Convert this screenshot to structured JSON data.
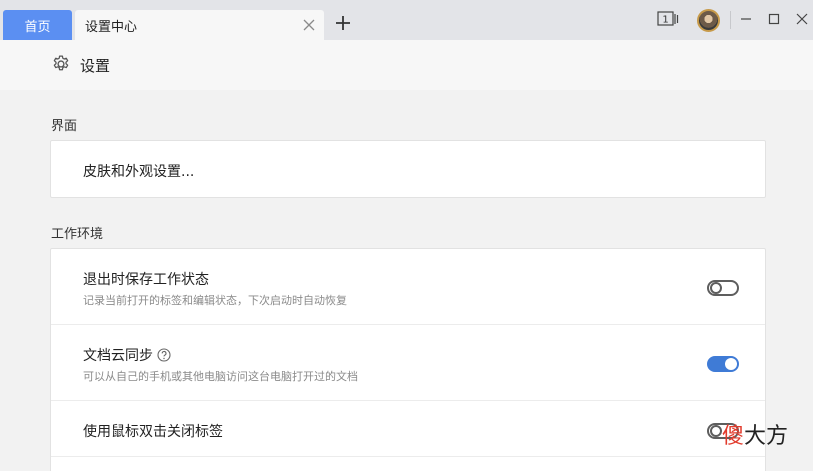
{
  "titlebar": {
    "home_tab_label": "首页",
    "active_tab_label": "设置中心",
    "window_count_badge": "1"
  },
  "header": {
    "title": "设置"
  },
  "sections": {
    "interface": {
      "label": "界面",
      "skin_row_title": "皮肤和外观设置..."
    },
    "work_env": {
      "label": "工作环境",
      "rows": [
        {
          "title": "退出时保存工作状态",
          "desc": "记录当前打开的标签和编辑状态，下次启动时自动恢复",
          "toggle": "off"
        },
        {
          "title": "文档云同步",
          "desc": "可以从自己的手机或其他电脑访问这台电脑打开过的文档",
          "toggle": "on"
        },
        {
          "title": "使用鼠标双击关闭标签",
          "desc": "",
          "toggle": "off"
        }
      ]
    }
  },
  "watermark": {
    "first_char": "傻",
    "rest": "大方"
  },
  "colors": {
    "accent": "#5b8ff2",
    "toggle_on": "#3f7bd6",
    "titlebar_bg": "#e3e4e8",
    "page_bg": "#f2f2f2"
  },
  "icons": {
    "tab_close": "close-icon",
    "new_tab": "plus-icon",
    "header": "gear-icon",
    "help": "question-circle-icon",
    "window_switch": "window-switch-icon",
    "minimize": "minimize-icon",
    "maximize": "maximize-icon",
    "close": "close-icon"
  }
}
